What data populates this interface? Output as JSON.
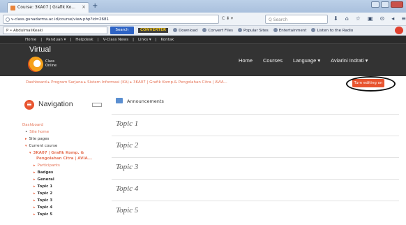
{
  "browser": {
    "tab_title": "Course: 3KA07 | Grafik Ko...",
    "tab_close": "×",
    "new_tab": "+",
    "url": "v-class.gunadarma.ac.id/course/view.php?id=2681",
    "url_controls": "C  ⬇ ▾",
    "search_placeholder": "Q Search",
    "nav_icons": [
      "⬇",
      "⌂",
      "☆",
      "▣",
      "⊙",
      "◂",
      "≡"
    ]
  },
  "toolbar": {
    "find_value": "P • AbdulmaliKeaki",
    "search_button": "Search",
    "items": [
      "CONVERTER",
      "Download",
      "Convert Files",
      "Popular Sites",
      "Entertainment",
      "Listen to the Radio"
    ]
  },
  "site": {
    "top_menu": [
      "Home",
      "Panduan ▾",
      "Helpdesk",
      "V-Class News",
      "Links ▾",
      "Kontak"
    ],
    "logo_word": "Virtual",
    "logo_sub_1": "Class",
    "logo_sub_2": "Online",
    "main_menu": [
      "Home",
      "Courses",
      "Language ▾",
      "Aviarini Indrati ▾"
    ]
  },
  "breadcrumb": "Dashboard ▸ Program Sarjana ▸ Sistem Informasi (KA) ▸ 3KA07 | Grafik Komp.& Pengolahan Citra | AVIA...",
  "edit_button": "Turn editing on",
  "navigation": {
    "title": "Navigation",
    "items": [
      {
        "label": "Dashboard",
        "kind": "link",
        "marker": ""
      },
      {
        "label": "Site home",
        "kind": "link",
        "marker": "•"
      },
      {
        "label": "Site pages",
        "kind": "text",
        "marker": "▸"
      },
      {
        "label": "Current course",
        "kind": "text",
        "marker": "▾"
      },
      {
        "label": "3KA07 | Grafik Komp. &",
        "kind": "link-bold",
        "marker": "▾"
      },
      {
        "label": "Pengolahan Citra | AVIA...",
        "kind": "link-bold",
        "marker": ""
      },
      {
        "label": "Participants",
        "kind": "link",
        "marker": "▸"
      },
      {
        "label": "Badges",
        "kind": "text",
        "marker": "▸"
      },
      {
        "label": "General",
        "kind": "text",
        "marker": "▸"
      },
      {
        "label": "Topic 1",
        "kind": "text",
        "marker": "▸"
      },
      {
        "label": "Topic 2",
        "kind": "text",
        "marker": "▸"
      },
      {
        "label": "Topic 3",
        "kind": "text",
        "marker": "▸"
      },
      {
        "label": "Topic 4",
        "kind": "text",
        "marker": "▸"
      },
      {
        "label": "Topic 5",
        "kind": "text",
        "marker": "▸"
      }
    ]
  },
  "content": {
    "announcements": "Announcements",
    "topics": [
      "Topic 1",
      "Topic 2",
      "Topic 3",
      "Topic 4",
      "Topic 5"
    ]
  }
}
